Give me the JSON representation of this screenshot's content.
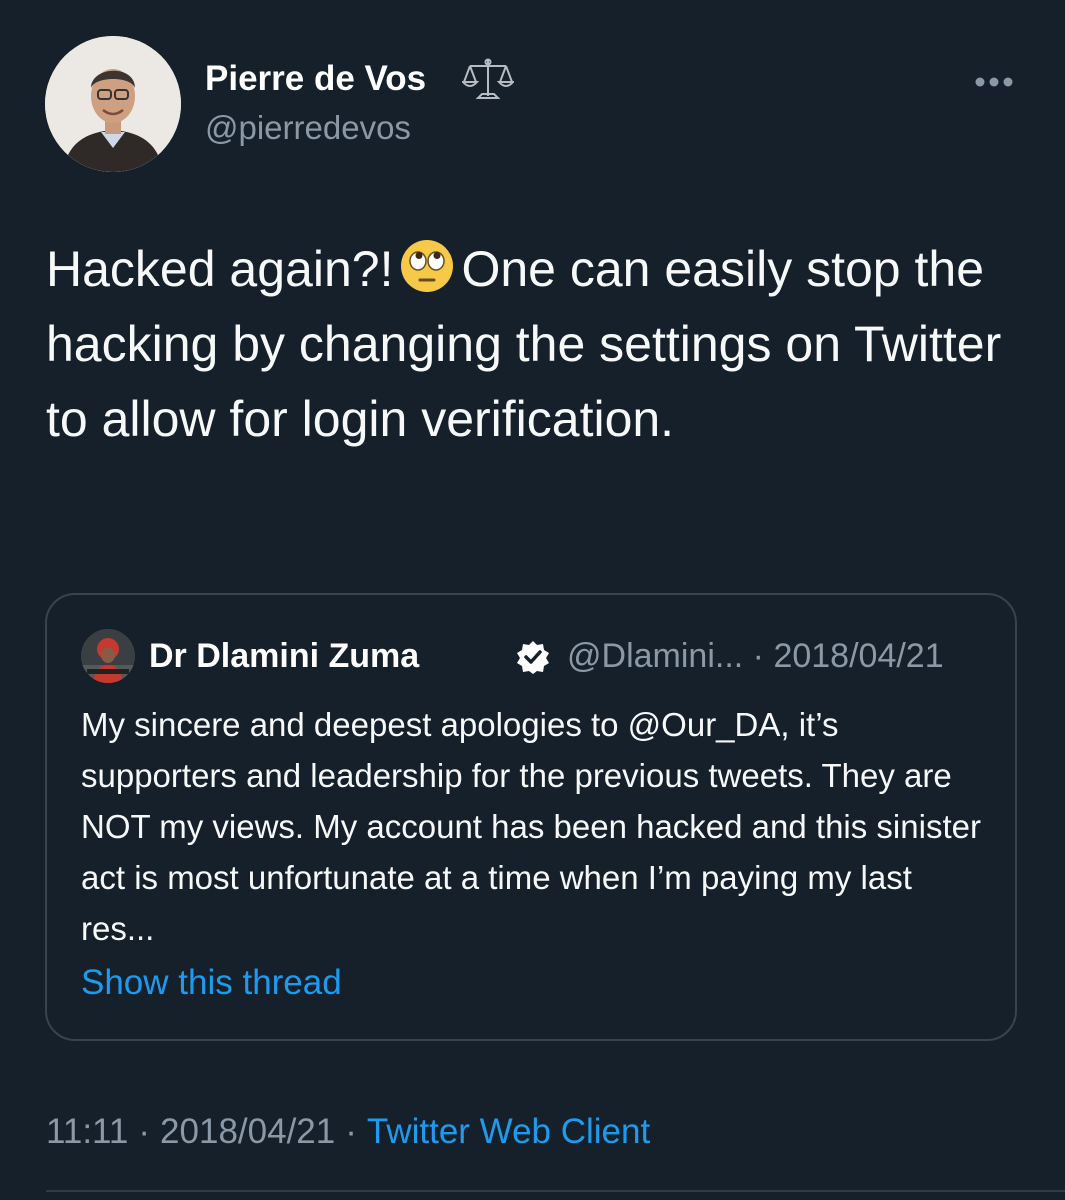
{
  "author": {
    "display_name": "Pierre de Vos",
    "handle": "@pierredevos",
    "badge_icon": "scales-icon"
  },
  "tweet": {
    "text_before_emoji": "Hacked again?!",
    "emoji": "face-with-rolling-eyes",
    "text_after_emoji": "One can easily stop the hacking by changing the settings on Twitter to allow for login verification."
  },
  "quoted_tweet": {
    "display_name": "Dr Dlamini Zuma",
    "verified": true,
    "handle": "@Dlamini...",
    "separator": "·",
    "date": "2018/04/21",
    "text": "My sincere and deepest apologies to @Our_DA, it’s supporters and leadership for the previous tweets. They are NOT my views. My account has been hacked and this sinister act is most unfortunate at a time when I’m paying my last res...",
    "show_thread_label": "Show this thread"
  },
  "footer": {
    "time": "11:11",
    "sep1": "·",
    "date": "2018/04/21",
    "sep2": "·",
    "client": "Twitter Web Client"
  },
  "colors": {
    "background": "#15202b",
    "text_primary": "#f7f9f9",
    "text_secondary": "#8b98a5",
    "link": "#1d9bf0",
    "border": "#38444d"
  }
}
